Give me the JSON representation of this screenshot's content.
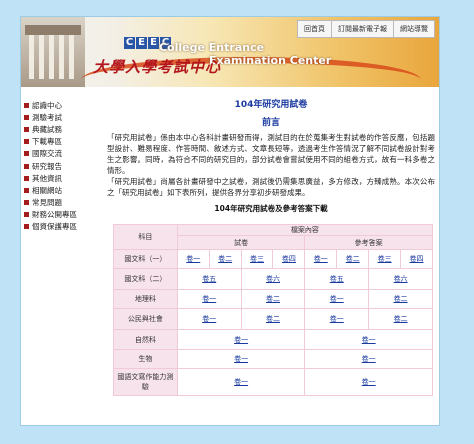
{
  "banner": {
    "logo_letters": [
      "C",
      "E",
      "E",
      "C"
    ],
    "en_line1": "College Entrance",
    "en_line2": "Examination Center",
    "zh_name": "大學入學考試中心"
  },
  "topnav": [
    "回首頁",
    "訂閱最新電子報",
    "網站導覽"
  ],
  "sidebar": {
    "items": [
      "認識中心",
      "測驗考試",
      "典藏試務",
      "下載專區",
      "國際交流",
      "研究報告",
      "其他資訊",
      "相關網站",
      "常見問題",
      "財務公開專區",
      "個資保護專區"
    ]
  },
  "main": {
    "title": "104年研究用試卷",
    "subtitle": "前言",
    "para1": "「研究用試卷」係由本中心各科計畫研發而得，測試目的在於蒐集考生對試卷的作答反應，包括題型設計、難易程度、作答時間、敘述方式、文章長短等，透過考生作答情況了解不同試卷設計對考生之影響。同時，為符合不同的研究目的，部分試卷會嘗試使用不同的組卷方式，故有一科多卷之情形。",
    "para2": "「研究用試卷」尚屬各計畫研發中之試卷，測試後仍需集思廣益，多方修改，方臻成熟。本次公布之「研究用試卷」如下表所列，提供各界分享初步研發成果。",
    "table_title": "104年研究用試卷及參考答案下載"
  },
  "table": {
    "col_subject": "科目",
    "col_file": "檔案內容",
    "col_paper": "試卷",
    "col_answer": "參考答案",
    "rows": [
      {
        "subject": "國文科（一）",
        "papers": [
          "卷一",
          "卷二",
          "卷三",
          "卷四"
        ],
        "answers": [
          "卷一",
          "卷二",
          "卷三",
          "卷四"
        ]
      },
      {
        "subject": "國文科（二）",
        "papers": [
          "卷五",
          "卷六"
        ],
        "answers": [
          "卷五",
          "卷六"
        ]
      },
      {
        "subject": "地理科",
        "papers": [
          "卷一",
          "卷二"
        ],
        "answers": [
          "卷一",
          "卷二"
        ]
      },
      {
        "subject": "公民與社會",
        "papers": [
          "卷一",
          "卷二"
        ],
        "answers": [
          "卷一",
          "卷二"
        ]
      },
      {
        "subject": "自然科",
        "papers": [
          "卷一"
        ],
        "answers": [
          "卷一"
        ]
      },
      {
        "subject": "生物",
        "papers": [
          "卷一"
        ],
        "answers": [
          "卷一"
        ]
      },
      {
        "subject": "國語文寫作能力測驗",
        "papers": [
          "卷一"
        ],
        "answers": [
          "卷一"
        ]
      }
    ]
  }
}
